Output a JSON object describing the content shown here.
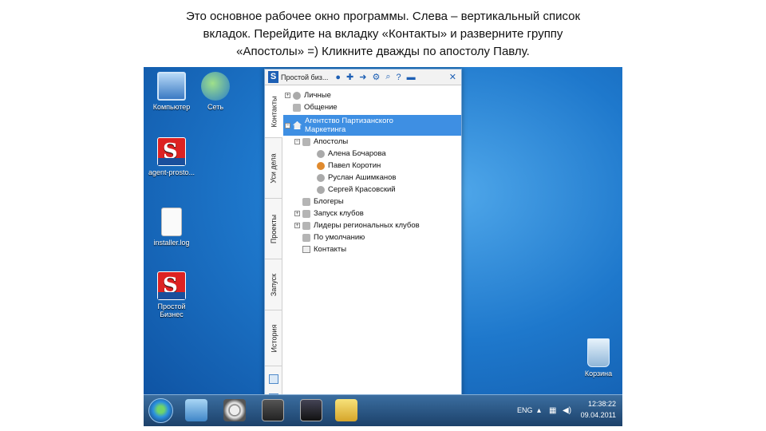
{
  "caption": {
    "line1": "Это основное рабочее окно программы. Слева – вертикальный список",
    "line2": "вкладок. Перейдите на вкладку «Контакты» и разверните группу",
    "line3": "«Апостолы» =)  Кликните дважды по апостолу Павлу."
  },
  "desktop_icons": {
    "computer": "Компьютер",
    "network": "Сеть",
    "recycle": "Корзина",
    "app1": "agent-prosto...",
    "file": "installer.log",
    "app2_line1": "Простой",
    "app2_line2": "Бизнес"
  },
  "app": {
    "title": "Простой биз...",
    "tabs": [
      "Контакты",
      "Уси дела",
      "Проекты",
      "Запуск",
      "История"
    ],
    "tree": {
      "personal": "Личные",
      "social": "Общение",
      "agency_line1": "Агентство Партизанского",
      "agency_line2": "Маркетинга",
      "apostles": "Апостолы",
      "members": [
        "Алена Бочарова",
        "Павел Коротин",
        "Руслан Ашимканов",
        "Сергей Красовский"
      ],
      "bloggers": "Блогеры",
      "club_launch": "Запуск клубов",
      "regional_leaders": "Лидеры региональных клубов",
      "default": "По умолчанию",
      "contacts": "Контакты"
    },
    "selected_item": "agency",
    "highlighted_member": "Павел Коротин"
  },
  "taskbar": {
    "lang": "ENG",
    "time": "12:38:22",
    "date": "09.04.2011"
  },
  "colors": {
    "selection": "#3e8fe3",
    "accent": "#1d5fb4",
    "highlight_person": "#e08a2e"
  }
}
